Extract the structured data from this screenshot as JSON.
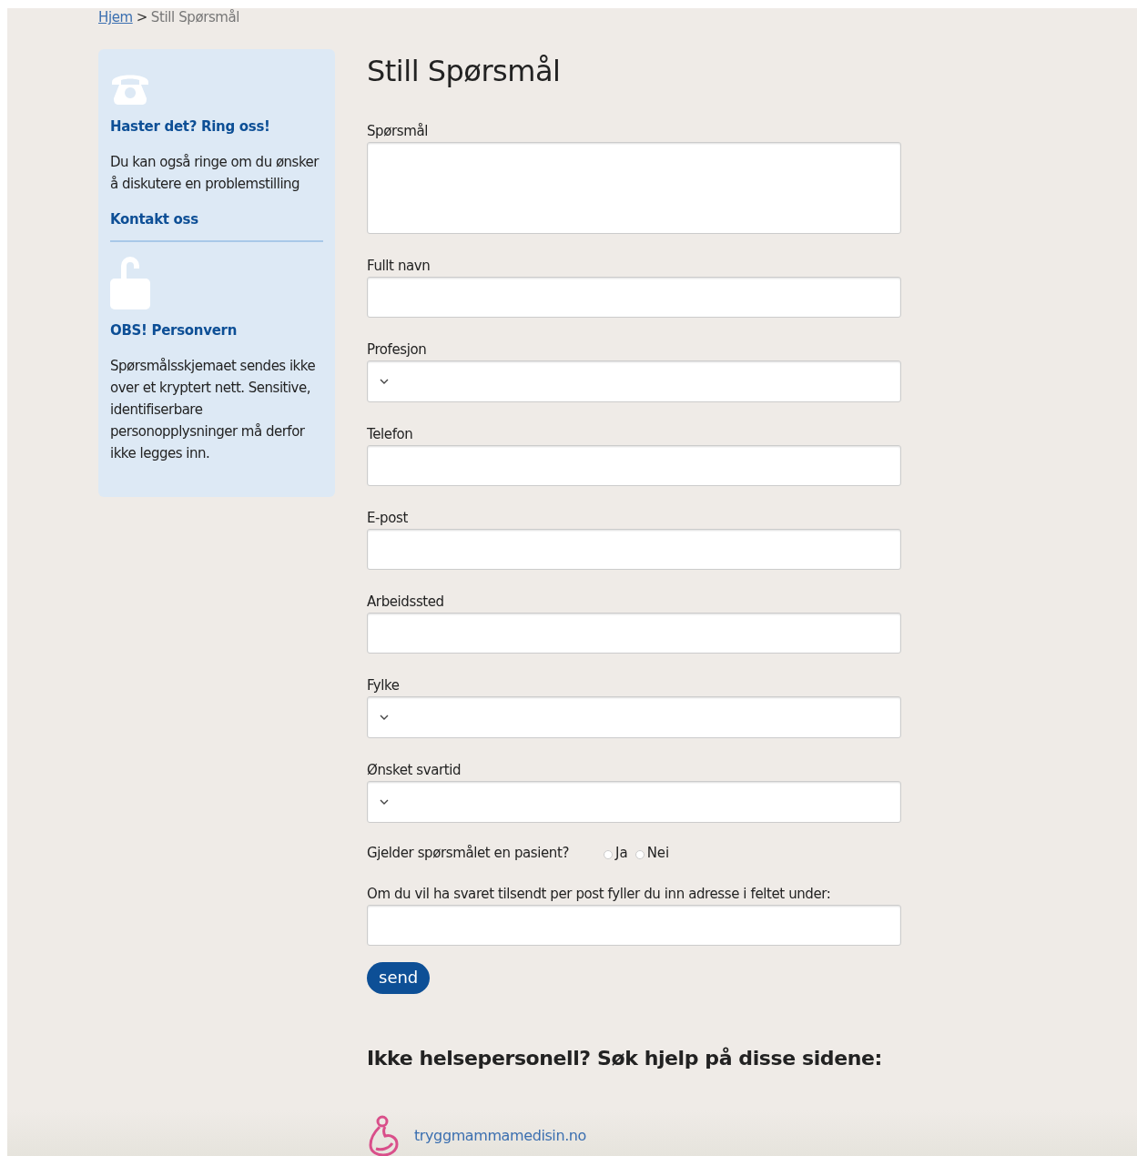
{
  "breadcrumb": {
    "home": "Hjem",
    "separator": ">",
    "current": "Still Spørsmål"
  },
  "sidebar": [
    {
      "kind": "phone",
      "heading": "Haster det? Ring oss!",
      "text": "Du kan også ringe om du ønsker å diskutere en problemstilling",
      "link": "Kontakt oss"
    },
    {
      "kind": "lock",
      "heading": "OBS! Personvern",
      "text": "Spørsmålsskjemaet sendes ikke over et kryptert nett. Sensitive, identifiserbare personopplysninger må derfor ikke legges inn."
    }
  ],
  "title": "Still Spørsmål",
  "fields": [
    {
      "label": "Spørsmål",
      "kind": "textarea"
    },
    {
      "label": "Fullt navn",
      "kind": "text"
    },
    {
      "label": "Profesjon",
      "kind": "select"
    },
    {
      "label": "Telefon",
      "kind": "text"
    },
    {
      "label": "E-post",
      "kind": "text"
    },
    {
      "label": "Arbeidssted",
      "kind": "text"
    },
    {
      "label": "Fylke",
      "kind": "select"
    },
    {
      "label": "Ønsket svartid",
      "kind": "select"
    }
  ],
  "patient_question": {
    "label": "Gjelder spørsmålet en pasient?",
    "options": [
      {
        "label": "Ja",
        "selected": false
      },
      {
        "label": "Nei",
        "selected": false
      }
    ]
  },
  "address": {
    "label": "Om du vil ha svaret tilsendt per post fyller du inn adresse i feltet under:"
  },
  "submit": "send",
  "other_help": {
    "heading": "Ikke helsepersonell? Søk hjelp på disse sidene:",
    "links": [
      "tryggmammamedisin.no"
    ]
  }
}
